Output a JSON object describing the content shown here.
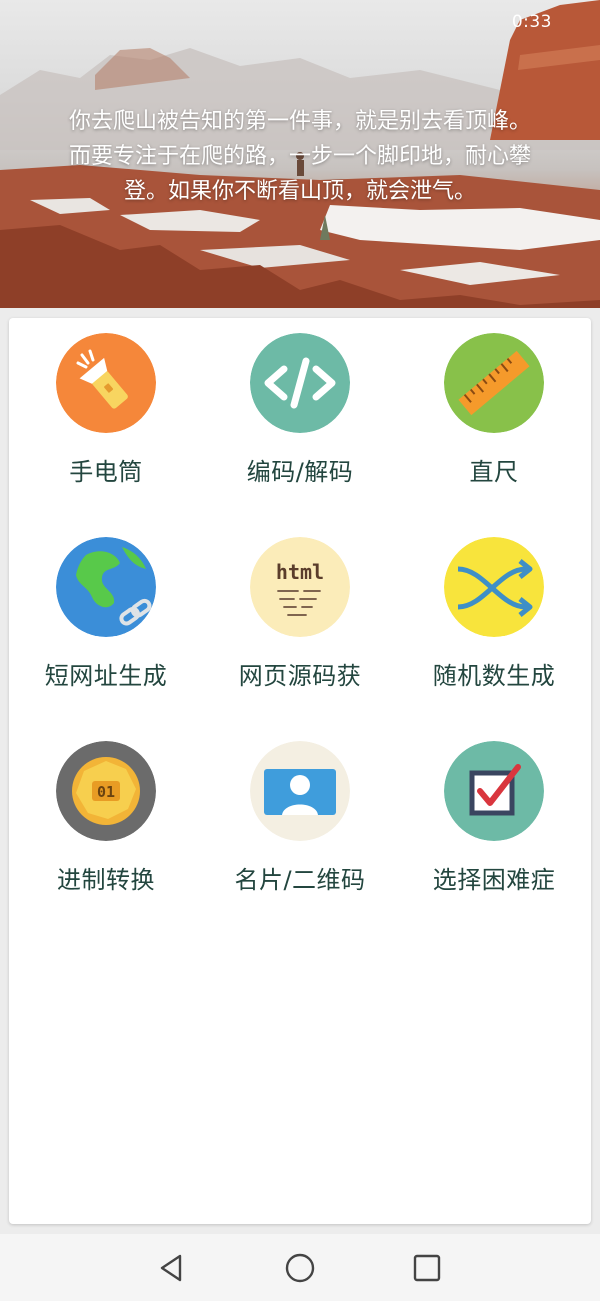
{
  "status_bar": {
    "time": "0:33"
  },
  "header": {
    "quote_line1": "你去爬山被告知的第一件事，就是别去看顶峰。",
    "quote_line2": "而要专注于在爬的路，一步一个脚印地，耐心攀",
    "quote_line3": "登。如果你不断看山顶，就会泄气。"
  },
  "tools": [
    {
      "label": "手电筒",
      "icon": "flashlight-icon",
      "color": "#f5873a"
    },
    {
      "label": "编码/解码",
      "icon": "code-icon",
      "color": "#6dbaa6"
    },
    {
      "label": "直尺",
      "icon": "ruler-icon",
      "color": "#88c14a"
    },
    {
      "label": "短网址生成",
      "icon": "globe-link-icon",
      "color": "#3b8ed8"
    },
    {
      "label": "网页源码获",
      "icon": "html-doc-icon",
      "color": "#fbecb9"
    },
    {
      "label": "随机数生成",
      "icon": "shuffle-icon",
      "color": "#f8e43c"
    },
    {
      "label": "进制转换",
      "icon": "binary-badge-icon",
      "color": "#6b6b6b"
    },
    {
      "label": "名片/二维码",
      "icon": "contact-card-icon",
      "color": "#f4efe2"
    },
    {
      "label": "选择困难症",
      "icon": "checkbox-icon",
      "color": "#6dbaa6"
    }
  ],
  "nav": {
    "back": "back-icon",
    "home": "home-icon",
    "recents": "recents-icon"
  }
}
